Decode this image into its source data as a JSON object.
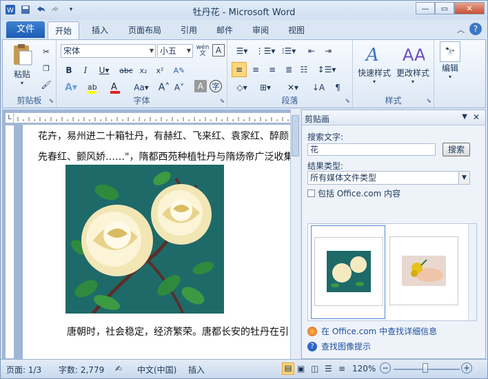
{
  "window": {
    "title": "牡丹花 - Microsoft Word"
  },
  "tabs": {
    "file": "文件",
    "items": [
      "开始",
      "插入",
      "页面布局",
      "引用",
      "邮件",
      "审阅",
      "视图"
    ]
  },
  "ribbon": {
    "clipboard": {
      "label": "剪贴板",
      "paste": "粘贴"
    },
    "font": {
      "label": "字体",
      "name": "宋体",
      "size": "小五",
      "wen": "wén"
    },
    "paragraph": {
      "label": "段落"
    },
    "styles": {
      "label": "样式",
      "quick": "快速样式",
      "change": "更改样式"
    },
    "editing": {
      "label": "编辑"
    }
  },
  "document": {
    "lines": [
      "花卉，易州进二十箱牡丹，有赫红、飞来红、袁家红、醉颜",
      "先春红、颤风娇……\"，隋都西苑种植牡丹与隋炀帝广泛收集",
      "唐朝时，社会稳定，经济繁荣。唐都长安的牡丹在引"
    ]
  },
  "clipart": {
    "title": "剪贴画",
    "search_label": "搜索文字:",
    "search_value": "花",
    "search_button": "搜索",
    "result_label": "结果类型:",
    "result_value": "所有媒体文件类型",
    "include_office": "包括 Office.com 内容",
    "link_more": "在 Office.com 中查找详细信息",
    "link_tips": "查找图像提示"
  },
  "status": {
    "page": "页面: 1/3",
    "words": "字数: 2,779",
    "lang": "中文(中国)",
    "mode": "插入",
    "zoom": "120%"
  },
  "colors": {
    "accent": "#2a62b8",
    "teal": "#1e6a69",
    "titlebar": "#d5e3f4"
  }
}
